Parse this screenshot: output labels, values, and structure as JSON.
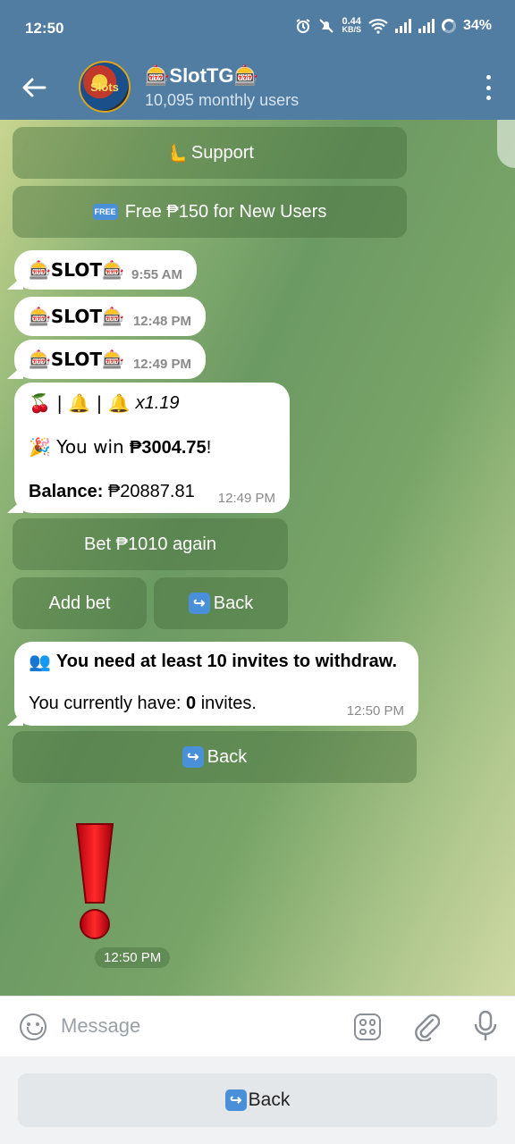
{
  "status_bar": {
    "time": "12:50",
    "net_speed_value": "0.44",
    "net_speed_unit": "KB/S",
    "battery": "34%"
  },
  "header": {
    "title": "🎰SlotTG🎰",
    "subtitle": "10,095 monthly users",
    "avatar_text": "Slots"
  },
  "keyboard_top": {
    "support_label": "Support",
    "support_emoji": "🫷",
    "free_label": "Free ₱150 for New Users",
    "free_badge": "FREE"
  },
  "slot_messages": [
    {
      "text": "🎰SLOT🎰",
      "time": "9:55 AM"
    },
    {
      "text": "🎰SLOT🎰",
      "time": "12:48 PM"
    },
    {
      "text": "🎰SLOT🎰",
      "time": "12:49 PM"
    }
  ],
  "result_message": {
    "line1_symbols": "🍒 | 🔔 | 🔔",
    "multiplier": "x1.19",
    "win_prefix": "🎉 You win ",
    "win_amount": "₱3004.75",
    "win_suffix": "!",
    "balance_label": "Balance: ",
    "balance_value": "₱20887.81",
    "time": "12:49 PM"
  },
  "result_buttons": {
    "bet_again": "Bet ₱1010 again",
    "add_bet": "Add bet",
    "back": "Back"
  },
  "withdraw_message": {
    "icon": "👥",
    "line1": "You need at least 10 invites to withdraw.",
    "line2_prefix": "You currently have: ",
    "line2_count": "0",
    "line2_suffix": " invites.",
    "time": "12:50 PM"
  },
  "withdraw_buttons": {
    "back": "Back"
  },
  "sticker": {
    "time": "12:50 PM"
  },
  "input": {
    "placeholder": "Message"
  },
  "reply_keyboard": {
    "back": "Back"
  },
  "colors": {
    "header_bg": "#517da2",
    "bubble_bg": "#ffffff",
    "exclamation_red": "#e0141e"
  }
}
